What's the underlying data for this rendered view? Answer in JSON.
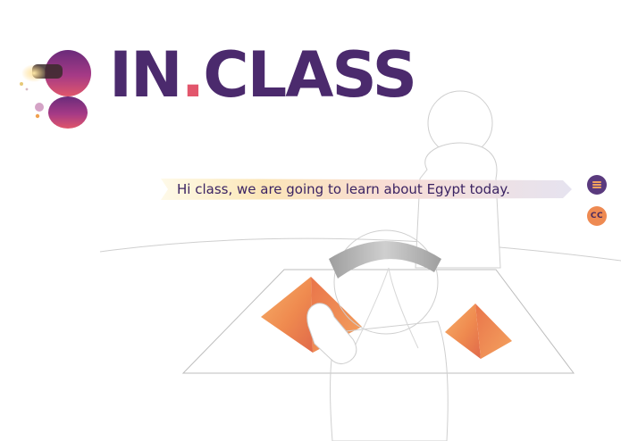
{
  "brand": {
    "name_main": "IN",
    "name_dot": ".",
    "name_rest": "CLASS"
  },
  "caption": {
    "text": "Hi class, we are going to learn about Egypt today."
  },
  "controls": {
    "menu_icon": "hamburger-icon",
    "cc_label": "CC"
  },
  "colors": {
    "brand_purple": "#4b2a6d",
    "accent_red": "#e2566c",
    "accent_orange": "#ee8a52",
    "button_purple": "#5a3a7e"
  }
}
